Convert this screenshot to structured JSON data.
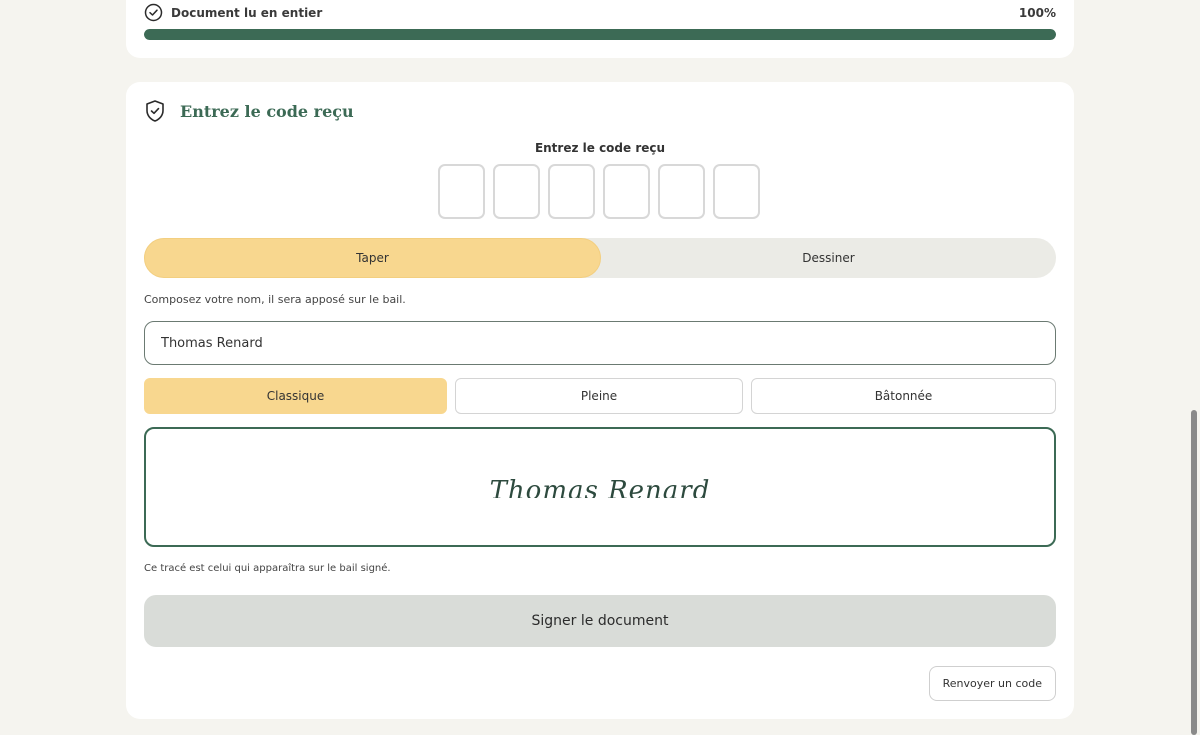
{
  "progress": {
    "label": "Document lu en entier",
    "percent_text": "100%",
    "value": 100
  },
  "code_section": {
    "title": "Entrez le code reçu",
    "code_label": "Entrez le code reçu",
    "digits": [
      "",
      "",
      "",
      "",
      "",
      ""
    ]
  },
  "mode_toggle": {
    "type_label": "Taper",
    "draw_label": "Dessiner",
    "active": "Taper"
  },
  "signature": {
    "help_text": "Composez votre nom, il sera apposé sur le bail.",
    "name_value": "Thomas Renard",
    "styles": [
      "Classique",
      "Pleine",
      "Bâtonnée"
    ],
    "active_style": "Classique",
    "preview_text": "Thomas Renard",
    "note": "Ce tracé est celui qui apparaîtra sur le bail signé."
  },
  "actions": {
    "sign_label": "Signer le document",
    "resend_label": "Renvoyer un code"
  },
  "colors": {
    "accent": "#3c6a55",
    "highlight": "#f8d78f",
    "background": "#f5f4ef"
  },
  "icons": {
    "progress": "check-circle-icon",
    "section": "shield-check-icon"
  }
}
